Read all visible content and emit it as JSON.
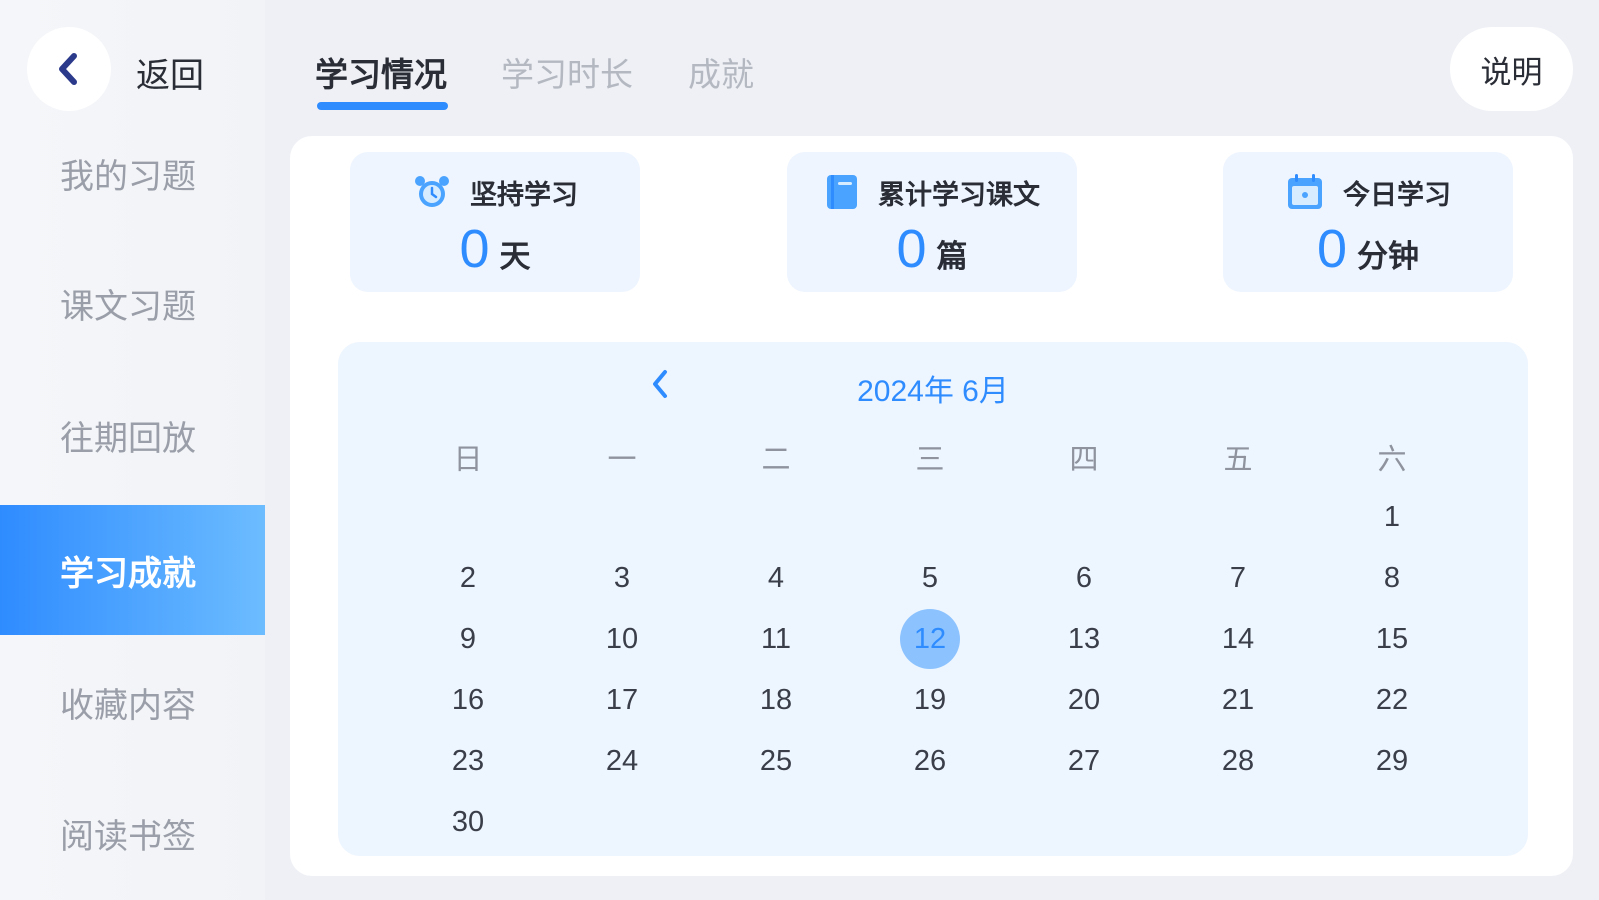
{
  "sidebar": {
    "back_label": "返回",
    "items": [
      {
        "label": "我的习题",
        "active": false
      },
      {
        "label": "课文习题",
        "active": false
      },
      {
        "label": "往期回放",
        "active": false
      },
      {
        "label": "学习成就",
        "active": true
      },
      {
        "label": "收藏内容",
        "active": false
      },
      {
        "label": "阅读书签",
        "active": false
      }
    ]
  },
  "tabs": [
    {
      "label": "学习情况",
      "active": true
    },
    {
      "label": "学习时长",
      "active": false
    },
    {
      "label": "成就",
      "active": false
    }
  ],
  "explain_label": "说明",
  "stats": [
    {
      "icon": "alarm-clock-icon",
      "label": "坚持学习",
      "value": "0",
      "unit": "天"
    },
    {
      "icon": "book-icon",
      "label": "累计学习课文",
      "value": "0",
      "unit": "篇"
    },
    {
      "icon": "calendar-icon",
      "label": "今日学习",
      "value": "0",
      "unit": "分钟"
    }
  ],
  "calendar": {
    "title": "2024年 6月",
    "weekdays": [
      "日",
      "一",
      "二",
      "三",
      "四",
      "五",
      "六"
    ],
    "first_weekday_index": 6,
    "days_in_month": 30,
    "today": 12
  },
  "colors": {
    "accent": "#2f8cff",
    "sidebar_active_start": "#2f8cff",
    "sidebar_active_end": "#6cbcff",
    "stat_bg": "#eef5ff",
    "calendar_bg": "#edf5ff",
    "today_circle": "#8cc3ff"
  }
}
